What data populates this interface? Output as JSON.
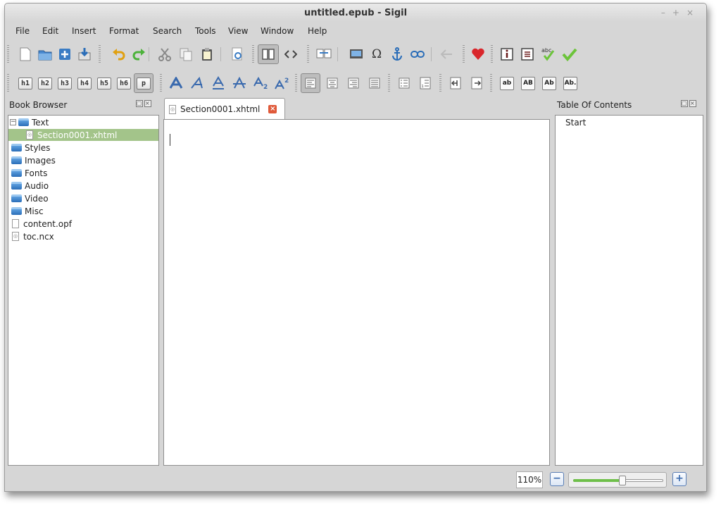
{
  "window": {
    "title": "untitled.epub - Sigil",
    "controls": [
      "–",
      "+",
      "×"
    ]
  },
  "menu": [
    {
      "label": "File"
    },
    {
      "label": "Edit"
    },
    {
      "label": "Insert"
    },
    {
      "label": "Format"
    },
    {
      "label": "Search"
    },
    {
      "label": "Tools"
    },
    {
      "label": "View"
    },
    {
      "label": "Window"
    },
    {
      "label": "Help"
    }
  ],
  "toolbar2": {
    "headings": [
      "h1",
      "h2",
      "h3",
      "h4",
      "h5",
      "h6",
      "p"
    ],
    "case_buttons": [
      "ab",
      "AB",
      "Ab",
      "Ab."
    ]
  },
  "book_browser": {
    "title": "Book Browser",
    "items": [
      {
        "label": "Text",
        "type": "folder",
        "expanded": true
      },
      {
        "label": "Section0001.xhtml",
        "type": "file",
        "selected": true
      },
      {
        "label": "Styles",
        "type": "folder"
      },
      {
        "label": "Images",
        "type": "folder"
      },
      {
        "label": "Fonts",
        "type": "folder"
      },
      {
        "label": "Audio",
        "type": "folder"
      },
      {
        "label": "Video",
        "type": "folder"
      },
      {
        "label": "Misc",
        "type": "folder"
      },
      {
        "label": "content.opf",
        "type": "file"
      },
      {
        "label": "toc.ncx",
        "type": "file"
      }
    ]
  },
  "editor": {
    "tab_label": "Section0001.xhtml"
  },
  "toc": {
    "title": "Table Of Contents",
    "items": [
      "Start"
    ]
  },
  "status": {
    "zoom": "110%",
    "zoom_fraction": 0.55
  },
  "colors": {
    "selection": "#a3c48a",
    "accent_blue": "#2a6db8",
    "heart": "#d9262b",
    "check": "#6cc43a"
  }
}
